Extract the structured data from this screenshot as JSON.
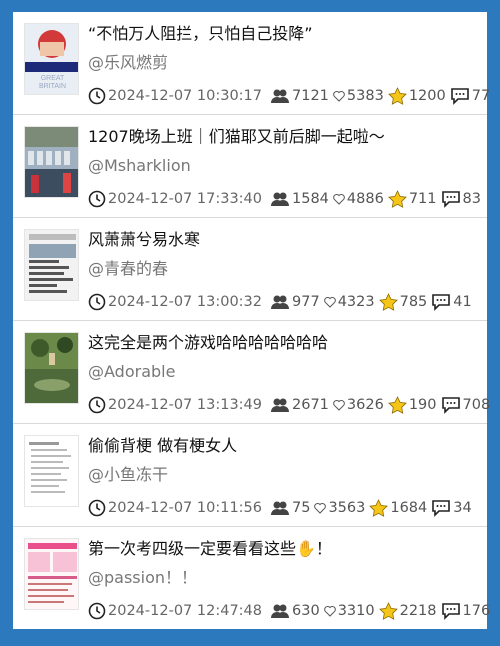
{
  "posts": [
    {
      "title": "“不怕万人阻拦，只怕自己投降”",
      "author": "@乐风燃剪",
      "time": "2024-12-07 10:30:17",
      "views": "7121",
      "likes": "5383",
      "favorites": "1200",
      "comments": "77",
      "thumb_text": [
        "GREAT",
        "BRITAIN"
      ]
    },
    {
      "title": "1207晚场上班｜们猫耶又前后脚一起啦～",
      "author": "@Msharklion",
      "time": "2024-12-07 17:33:40",
      "views": "1584",
      "likes": "4886",
      "favorites": "711",
      "comments": "83"
    },
    {
      "title": "风萧萧兮易水寒",
      "author": "@青春的春",
      "time": "2024-12-07 13:00:32",
      "views": "977",
      "likes": "4323",
      "favorites": "785",
      "comments": "41"
    },
    {
      "title": "这完全是两个游戏哈哈哈哈哈哈哈",
      "author": "@Adorable",
      "time": "2024-12-07 13:13:49",
      "views": "2671",
      "likes": "3626",
      "favorites": "190",
      "comments": "708"
    },
    {
      "title": "偷偷背梗 做有梗女人",
      "author": "@小鱼冻干",
      "time": "2024-12-07 10:11:56",
      "views": "75",
      "likes": "3563",
      "favorites": "1684",
      "comments": "34"
    },
    {
      "title": "第一次考四级一定要看看这些✋！",
      "author": "@passion！！",
      "time": "2024-12-07 12:47:48",
      "views": "630",
      "likes": "3310",
      "favorites": "2218",
      "comments": "176"
    }
  ],
  "colors": {
    "background": "#2d79bd",
    "star": "#f5c518"
  }
}
